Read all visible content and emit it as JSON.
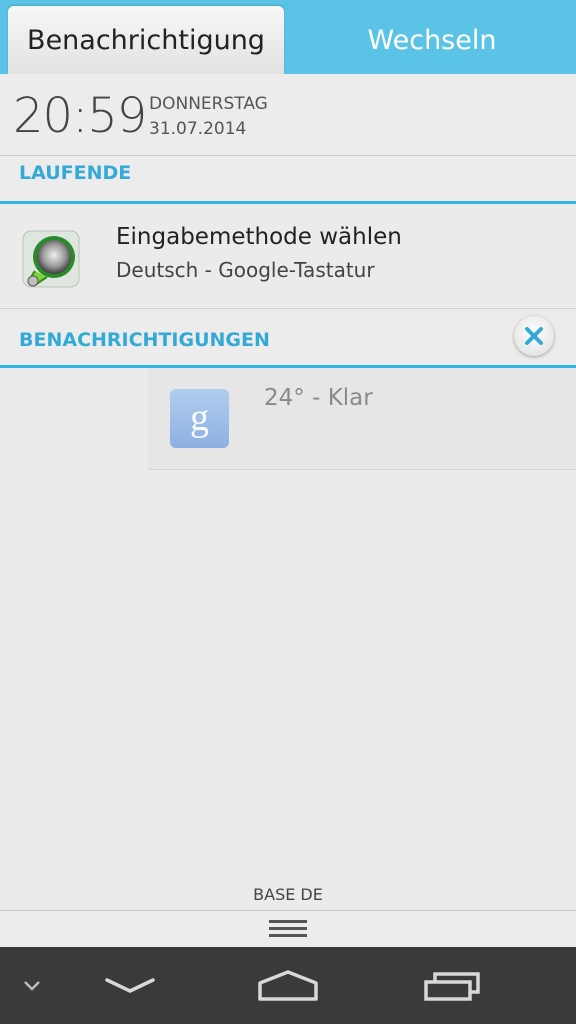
{
  "tabs": {
    "notifications": "Benachrichtigung",
    "switch": "Wechseln"
  },
  "clock": {
    "time": "20:59",
    "weekday": "DONNERSTAG",
    "date": "31.07.2014"
  },
  "ongoing": {
    "header": "LAUFENDE",
    "item": {
      "title": "Eingabemethode wählen",
      "subtitle": "Deutsch - Google-Tastatur",
      "icon": "input-method-icon"
    }
  },
  "notifications": {
    "header": "BENACHRICHTIGUNGEN",
    "clear_icon": "clear-all-icon",
    "items": [
      {
        "title": "24° - Klar",
        "icon": "google-icon"
      }
    ]
  },
  "carrier": "BASE DE",
  "colors": {
    "accent": "#33b5e5",
    "tabbar": "#5bc3e6",
    "navbar": "#3a3a3a"
  }
}
